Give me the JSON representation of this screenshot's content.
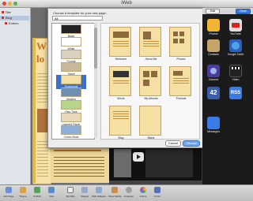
{
  "window": {
    "title": "iWeb"
  },
  "colors": {
    "accent": "#3d6fc2",
    "page_bg": "#f6e2a7",
    "headline": "#c9711d",
    "canvas": "#6e6e6e"
  },
  "sidebar": {
    "items": [
      {
        "label": "Site",
        "selected": false
      },
      {
        "label": "Blog",
        "selected": true
      },
      {
        "label": "Entries",
        "selected": false
      }
    ]
  },
  "page": {
    "headline_line1": "W",
    "headline_line2": "lo",
    "video_icon": "play-icon"
  },
  "dialog": {
    "title": "Choose a template for your new page:",
    "theme_select": "All",
    "themes": [
      {
        "label": "Black",
        "selected": false
      },
      {
        "label": "White",
        "selected": false
      },
      {
        "label": "Formal",
        "selected": false
      },
      {
        "label": "Travel",
        "selected": false
      },
      {
        "label": "Scrapbook",
        "selected": true
      },
      {
        "label": "Modern",
        "selected": false
      },
      {
        "label": "Play Time",
        "selected": false
      },
      {
        "label": "Layered Paper",
        "selected": false
      },
      {
        "label": "Comic Book",
        "selected": false
      }
    ],
    "templates": [
      {
        "label": "Welcome"
      },
      {
        "label": "About Me"
      },
      {
        "label": "Photos"
      },
      {
        "label": "Movie"
      },
      {
        "label": "My Albums"
      },
      {
        "label": "Podcast"
      },
      {
        "label": "Blog"
      },
      {
        "label": "Blank"
      }
    ],
    "cancel_label": "Cancel",
    "choose_label": "Choose"
  },
  "ipad": {
    "top_buttons": [
      "Edit",
      "Done"
    ],
    "apps": [
      {
        "label": "Photos",
        "color": "#f2b632",
        "icon": "photos-icon"
      },
      {
        "label": "YouTube",
        "color": "#e0e0e0",
        "icon": "youtube-icon"
      },
      {
        "label": "Contacts",
        "color": "#c8a46a",
        "icon": "contacts-icon"
      },
      {
        "label": "Google Earth",
        "color": "#2b62b8",
        "icon": "globe-icon"
      },
      {
        "label": "Camera",
        "color": "#4a3d9c",
        "icon": "camera-icon"
      },
      {
        "label": "Video",
        "color": "#222222",
        "icon": "clapper-icon"
      },
      {
        "label": "42",
        "color": "#3a5fa8",
        "icon": "number-icon"
      },
      {
        "label": "RSS",
        "color": "#3b7be0",
        "icon": "rss-icon"
      },
      {
        "label": "Messages",
        "color": "#3a7be8",
        "icon": "messages-icon"
      }
    ]
  },
  "toolbar": {
    "items": [
      {
        "label": "Add Page",
        "color": "#6b8fd6",
        "icon": "add-page-icon"
      },
      {
        "label": "Theme",
        "color": "#d8a24a",
        "icon": "theme-icon"
      },
      {
        "label": "Publish",
        "color": "#5aa05a",
        "icon": "publish-icon"
      },
      {
        "label": "Visit",
        "color": "#5b8ac9",
        "icon": "visit-icon"
      },
      {
        "label": "Text Box",
        "color": "#eeeeee",
        "icon": "textbox-icon"
      },
      {
        "label": "Shapes",
        "color": "#9aa9c9",
        "icon": "shapes-icon"
      },
      {
        "label": "Web Widgets",
        "color": "#8fa7c8",
        "icon": "widgets-icon"
      },
      {
        "label": "Show Media",
        "color": "#c98e4e",
        "icon": "media-icon"
      },
      {
        "label": "Inspector",
        "color": "#a0a0a0",
        "icon": "inspector-icon"
      },
      {
        "label": "Colors",
        "color": "#e2695a",
        "icon": "colors-icon"
      },
      {
        "label": "Fonts",
        "color": "#5770b5",
        "icon": "fonts-icon"
      }
    ]
  }
}
